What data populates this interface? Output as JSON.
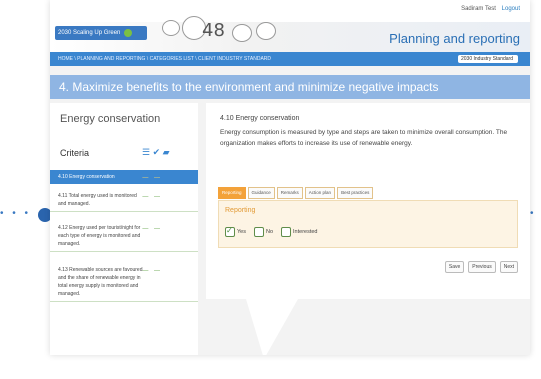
{
  "header": {
    "user_name": "Sadiram Test",
    "logout_label": "Logout",
    "banner_title": "Planning and reporting",
    "banner_number": "48",
    "logo_text": "2030 Scaling Up Green"
  },
  "breadcrumb": {
    "text": "HOME \\ PLANNING AND REPORTING \\ CATEGORIES LIST \\ CLIENT INDUSTRY STANDARD",
    "selector_value": "2030 Industry Standard"
  },
  "section_title": "4. Maximize benefits to the environment and minimize negative impacts",
  "left_panel": {
    "title": "Energy conservation",
    "criteria_label": "Criteria",
    "items": [
      {
        "label": "4.10 Energy conservation",
        "active": true
      },
      {
        "label": "4.11 Total energy used is monitored and managed."
      },
      {
        "label": "4.12 Energy used per tourist/night for each type of energy is monitored and managed."
      },
      {
        "label": "4.13 Renewable sources are favoured and the share of renewable energy in total energy supply is monitored and managed."
      }
    ]
  },
  "detail": {
    "title": "4.10 Energy conservation",
    "description": "Energy consumption is measured by type and steps are taken to minimize overall consumption. The organization makes efforts to increase its use of renewable energy.",
    "tabs": [
      "Reporting",
      "Guidance",
      "Remarks",
      "Action plan",
      "Best practices"
    ],
    "reporting_label": "Reporting",
    "options": [
      {
        "label": "Yes",
        "checked": true
      },
      {
        "label": "No",
        "checked": false
      },
      {
        "label": "Interested",
        "checked": false
      }
    ],
    "buttons": {
      "save": "Save",
      "previous": "Previous",
      "next": "Next"
    }
  },
  "colors": {
    "accent": "#3a86d0",
    "header_bar": "#8fb5e3",
    "tab_active": "#f3a23a",
    "panel_bg": "#fdf4e4"
  }
}
